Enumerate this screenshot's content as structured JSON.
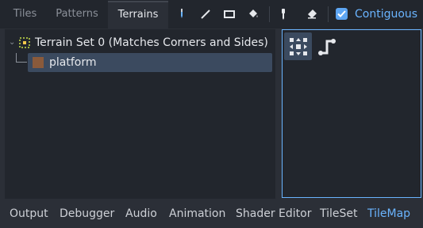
{
  "tabs": [
    {
      "label": "Tiles",
      "active": false
    },
    {
      "label": "Patterns",
      "active": false
    },
    {
      "label": "Terrains",
      "active": true
    }
  ],
  "toolbar": {
    "tools": [
      "paint-icon",
      "line-icon",
      "rect-icon",
      "bucket-icon",
      "picker-icon",
      "eraser-icon"
    ],
    "contiguous_label": "Contiguous",
    "contiguous_checked": true
  },
  "tree": {
    "terrain_set_label": "Terrain Set 0 (Matches Corners and Sides)",
    "terrain_label": "platform",
    "terrain_color": "#8a5a3b"
  },
  "modes": [
    "connect-mode-icon",
    "path-mode-icon"
  ],
  "bottom_panel": {
    "items": [
      {
        "label": "Output",
        "active": false
      },
      {
        "label": "Debugger",
        "active": false
      },
      {
        "label": "Audio",
        "active": false
      },
      {
        "label": "Animation",
        "active": false
      },
      {
        "label": "Shader Editor",
        "active": false
      },
      {
        "label": "TileSet",
        "active": false
      },
      {
        "label": "TileMap",
        "active": true
      }
    ]
  },
  "colors": {
    "accent": "#6ab4ff",
    "panel_bg": "#22262d",
    "window_bg": "#2b2f37",
    "selection": "#3b4a5f"
  }
}
